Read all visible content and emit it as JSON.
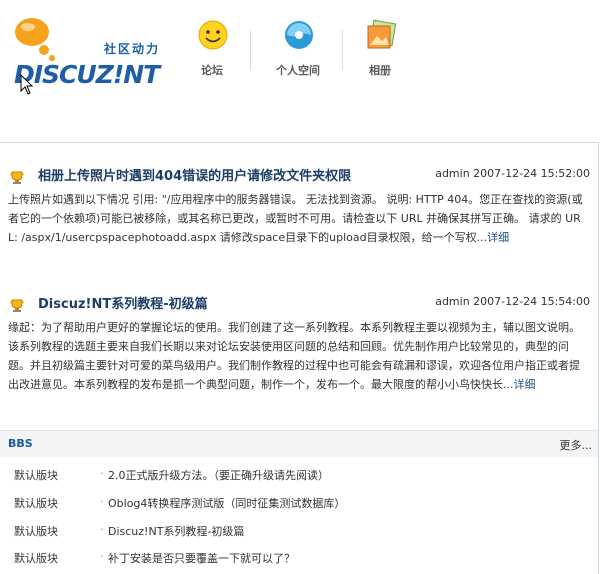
{
  "header": {
    "slogan": "社区动力",
    "brand": "DISCUZ!NT",
    "nav": [
      {
        "label": "论坛",
        "icon": "smiley-forum-icon"
      },
      {
        "label": "个人空间",
        "icon": "personal-space-swirl-icon"
      },
      {
        "label": "相册",
        "icon": "photo-album-icon"
      }
    ]
  },
  "posts": [
    {
      "title": "相册上传照片时遇到404错误的用户请修改文件夹权限",
      "author": "admin",
      "datetime": "2007-12-24 15:52:00",
      "body": "上传照片如遇到以下情况 引用: \"/应用程序中的服务器错误。 无法找到资源。 说明: HTTP 404。您正在查找的资源(或者它的一个依赖项)可能已被移除，或其名称已更改，或暂时不可用。请检查以下 URL 并确保其拼写正确。 请求的 URL: /aspx/1/usercpspacephotoadd.aspx 请修改space目录下的upload目录权限，给一个写权...",
      "more": "详细"
    },
    {
      "title": "Discuz!NT系列教程-初级篇",
      "author": "admin",
      "datetime": "2007-12-24 15:54:00",
      "body": "缘起：为了帮助用户更好的掌握论坛的使用。我们创建了这一系列教程。本系列教程主要以视频为主，辅以图文说明。该系列教程的选题主要来自我们长期以来对论坛安装使用区问题的总结和回顾。优先制作用户比较常见的，典型的问题。并且初级篇主要针对可爱的菜鸟级用户。我们制作教程的过程中也可能会有疏漏和谬误，欢迎各位用户指正或者提出改进意见。本系列教程的发布是抓一个典型问题，制作一个，发布一个。最大限度的帮小小鸟快快长...",
      "more": "详细"
    }
  ],
  "bbs": {
    "title": "BBS",
    "more": "更多...",
    "rows": [
      {
        "category": "默认版块",
        "subject": "2.0正式版升级方法。（要正确升级请先阅读）"
      },
      {
        "category": "默认版块",
        "subject": "Oblog4转换程序测试版（同时征集测试数据库）"
      },
      {
        "category": "默认版块",
        "subject": "Discuz!NT系列教程-初级篇"
      },
      {
        "category": "默认版块",
        "subject": "补丁安装是否只要覆盖一下就可以了？"
      }
    ]
  }
}
